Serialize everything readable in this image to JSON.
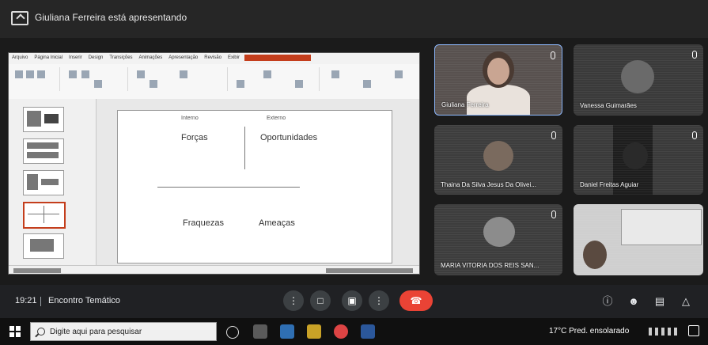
{
  "presenter_banner": {
    "text": "Giuliana Ferreira está apresentando"
  },
  "participants": [
    {
      "name": "Giuliana Ferreira"
    },
    {
      "name": "Vanessa Guimarães"
    },
    {
      "name": "Thaina Da Silva Jesus Da Olivei..."
    },
    {
      "name": "Daniel Freitas Aguiar"
    },
    {
      "name": "MARIA VITORIA DOS REIS SAN..."
    },
    {
      "name": ""
    }
  ],
  "slide": {
    "col_left": "Interno",
    "col_right": "Externo",
    "cells": [
      "Forças",
      "Oportunidades",
      "Fraquezas",
      "Ameaças"
    ]
  },
  "meeting": {
    "time": "19:21",
    "name": "Encontro Temático"
  },
  "taskbar": {
    "search_placeholder": "Digite aqui para pesquisar",
    "weather": "17°C Pred. ensolarado"
  }
}
